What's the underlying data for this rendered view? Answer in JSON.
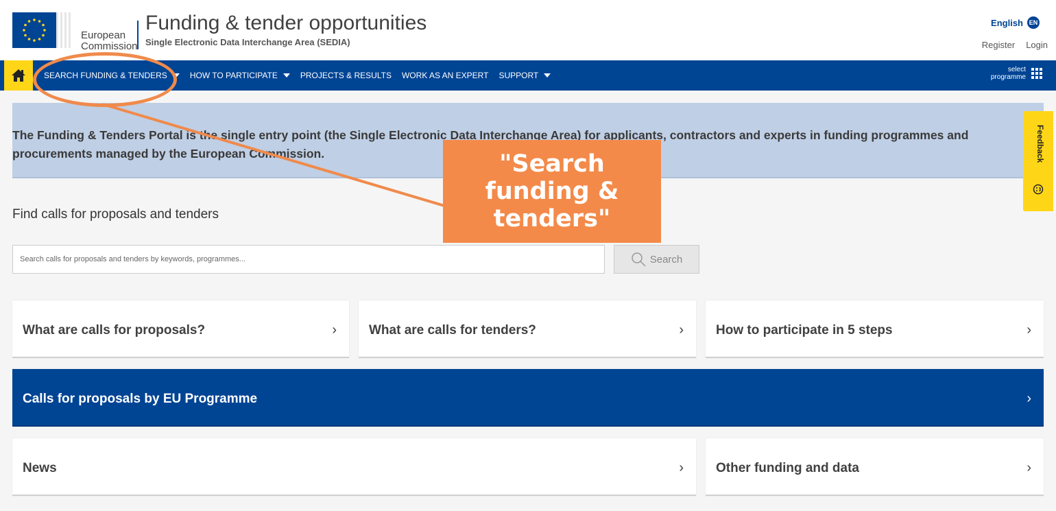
{
  "header": {
    "logo_line1": "European",
    "logo_line2": "Commission",
    "title": "Funding & tender opportunities",
    "subtitle": "Single Electronic Data Interchange Area (SEDIA)",
    "language": "English",
    "language_code": "EN",
    "register": "Register",
    "login": "Login"
  },
  "nav": {
    "items": [
      {
        "label": "SEARCH FUNDING & TENDERS",
        "dropdown": true
      },
      {
        "label": "HOW TO PARTICIPATE",
        "dropdown": true
      },
      {
        "label": "PROJECTS & RESULTS",
        "dropdown": false
      },
      {
        "label": "WORK AS AN EXPERT",
        "dropdown": false
      },
      {
        "label": "SUPPORT",
        "dropdown": true
      }
    ],
    "select_programme_line1": "select",
    "select_programme_line2": "programme"
  },
  "intro": {
    "text": "The Funding & Tenders Portal is the single entry point (the Single Electronic Data Interchange Area) for applicants, contractors and experts in funding programmes and procurements managed by the European Commission."
  },
  "feedback": {
    "label": "Feedback"
  },
  "find": {
    "heading": "Find calls for proposals and tenders",
    "placeholder": "Search calls for proposals and tenders by keywords, programmes...",
    "button": "Search"
  },
  "cards": {
    "calls_for_proposals": "What are calls for proposals?",
    "calls_for_tenders": "What are calls for tenders?",
    "how_to_participate": "How to participate in 5 steps",
    "by_programme": "Calls for proposals by EU Programme",
    "news": "News",
    "other_funding": "Other funding and data"
  },
  "annotation": {
    "callout": "\"Search\nfunding &\ntenders\""
  },
  "colors": {
    "brand_blue": "#004494",
    "accent_yellow": "#ffd617",
    "intro_bg": "#bfcfe5",
    "annotation_orange": "#f38a4a"
  }
}
